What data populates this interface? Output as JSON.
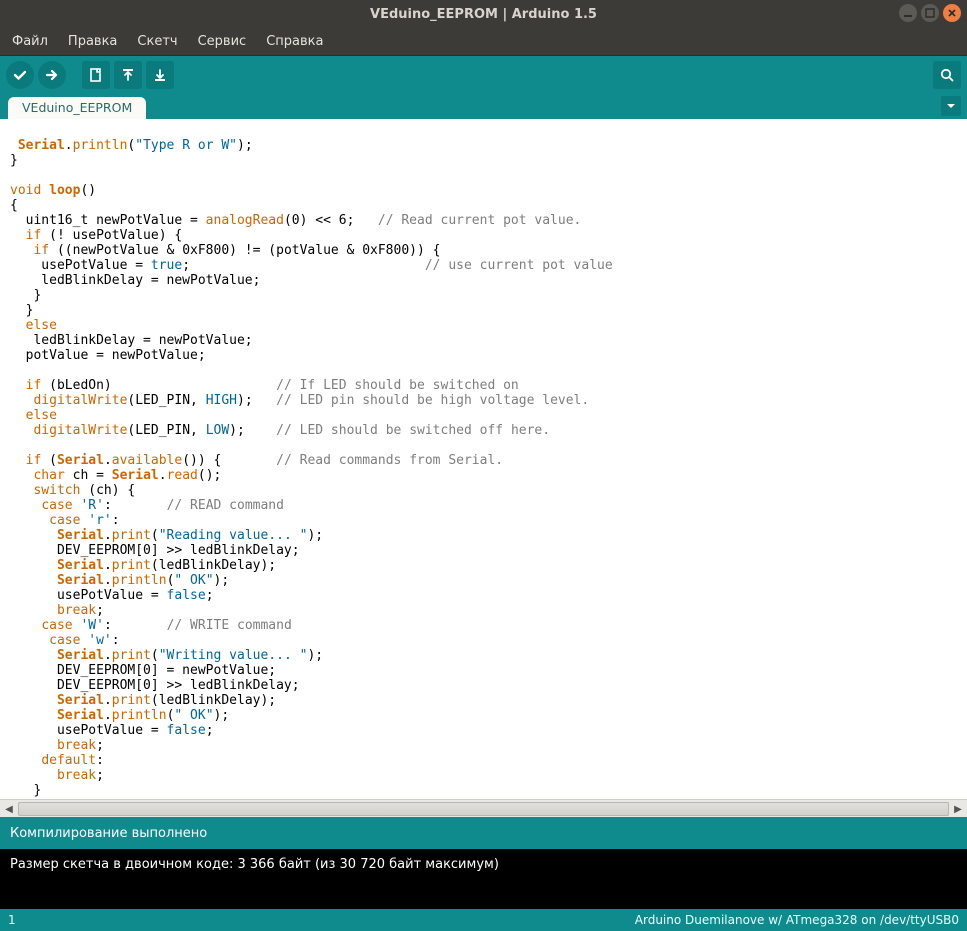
{
  "window": {
    "title": "VEduino_EEPROM | Arduino 1.5"
  },
  "menu": {
    "file": "Файл",
    "edit": "Правка",
    "sketch": "Скетч",
    "service": "Сервис",
    "help": "Справка"
  },
  "tabs": {
    "active": "VEduino_EEPROM"
  },
  "status": {
    "compile_done": "Компилирование выполнено"
  },
  "console": {
    "line1": "Размер скетча в двоичном коде: 3 366 байт (из 30 720 байт максимум)"
  },
  "footer": {
    "line": "1",
    "board": "Arduino Duemilanove w/ ATmega328 on /dev/ttyUSB0"
  },
  "code": {
    "l01a": "Serial",
    "l01b": ".",
    "l01c": "println",
    "l01d": "(",
    "l01e": "\"Type R or W\"",
    "l01f": ");",
    "l02": "}",
    "l03": "",
    "l04a": "void",
    "l04b": " ",
    "l04c": "loop",
    "l04d": "()",
    "l05": "{",
    "l06a": "  uint16_t newPotValue = ",
    "l06b": "analogRead",
    "l06c": "(0) << 6;   ",
    "l06d": "// Read current pot value.",
    "l07a": "  ",
    "l07b": "if",
    "l07c": " (! usePotValue) {",
    "l08a": "   ",
    "l08b": "if",
    "l08c": " ((newPotValue & 0xF800) != (potValue & 0xF800)) {",
    "l09a": "    usePotValue = ",
    "l09b": "true",
    "l09c": ";                              ",
    "l09d": "// use current pot value",
    "l10": "    ledBlinkDelay = newPotValue;",
    "l11": "   }",
    "l12": "  }",
    "l13a": "  ",
    "l13b": "else",
    "l14": "   ledBlinkDelay = newPotValue;",
    "l15": "  potValue = newPotValue;",
    "l16": "",
    "l17a": "  ",
    "l17b": "if",
    "l17c": " (bLedOn)                     ",
    "l17d": "// If LED should be switched on",
    "l18a": "   ",
    "l18b": "digitalWrite",
    "l18c": "(LED_PIN, ",
    "l18d": "HIGH",
    "l18e": ");   ",
    "l18f": "// LED pin should be high voltage level.",
    "l19a": "  ",
    "l19b": "else",
    "l20a": "   ",
    "l20b": "digitalWrite",
    "l20c": "(LED_PIN, ",
    "l20d": "LOW",
    "l20e": ");    ",
    "l20f": "// LED should be switched off here.",
    "l21": "",
    "l22a": "  ",
    "l22b": "if",
    "l22c": " (",
    "l22d": "Serial",
    "l22e": ".",
    "l22f": "available",
    "l22g": "()) {       ",
    "l22h": "// Read commands from Serial.",
    "l23a": "   ",
    "l23b": "char",
    "l23c": " ch = ",
    "l23d": "Serial",
    "l23e": ".",
    "l23f": "read",
    "l23g": "();",
    "l24a": "   ",
    "l24b": "switch",
    "l24c": " (ch) {",
    "l25a": "    ",
    "l25b": "case",
    "l25c": " ",
    "l25d": "'R'",
    "l25e": ":       ",
    "l25f": "// READ command",
    "l26a": "     ",
    "l26b": "case",
    "l26c": " ",
    "l26d": "'r'",
    "l26e": ":",
    "l27a": "      ",
    "l27b": "Serial",
    "l27c": ".",
    "l27d": "print",
    "l27e": "(",
    "l27f": "\"Reading value... \"",
    "l27g": ");",
    "l28": "      DEV_EEPROM[0] >> ledBlinkDelay;",
    "l29a": "      ",
    "l29b": "Serial",
    "l29c": ".",
    "l29d": "print",
    "l29e": "(ledBlinkDelay);",
    "l30a": "      ",
    "l30b": "Serial",
    "l30c": ".",
    "l30d": "println",
    "l30e": "(",
    "l30f": "\" OK\"",
    "l30g": ");",
    "l31a": "      usePotValue = ",
    "l31b": "false",
    "l31c": ";",
    "l32a": "      ",
    "l32b": "break",
    "l32c": ";",
    "l33a": "    ",
    "l33b": "case",
    "l33c": " ",
    "l33d": "'W'",
    "l33e": ":       ",
    "l33f": "// WRITE command",
    "l34a": "     ",
    "l34b": "case",
    "l34c": " ",
    "l34d": "'w'",
    "l34e": ":",
    "l35a": "      ",
    "l35b": "Serial",
    "l35c": ".",
    "l35d": "print",
    "l35e": "(",
    "l35f": "\"Writing value... \"",
    "l35g": ");",
    "l36": "      DEV_EEPROM[0] = newPotValue;",
    "l37": "      DEV_EEPROM[0] >> ledBlinkDelay;",
    "l38a": "      ",
    "l38b": "Serial",
    "l38c": ".",
    "l38d": "print",
    "l38e": "(ledBlinkDelay);",
    "l39a": "      ",
    "l39b": "Serial",
    "l39c": ".",
    "l39d": "println",
    "l39e": "(",
    "l39f": "\" OK\"",
    "l39g": ");",
    "l40a": "      usePotValue = ",
    "l40b": "false",
    "l40c": ";",
    "l41a": "      ",
    "l41b": "break",
    "l41c": ";",
    "l42a": "    ",
    "l42b": "default",
    "l42c": ":",
    "l43a": "      ",
    "l43b": "break",
    "l43c": ";",
    "l44": "   }"
  }
}
